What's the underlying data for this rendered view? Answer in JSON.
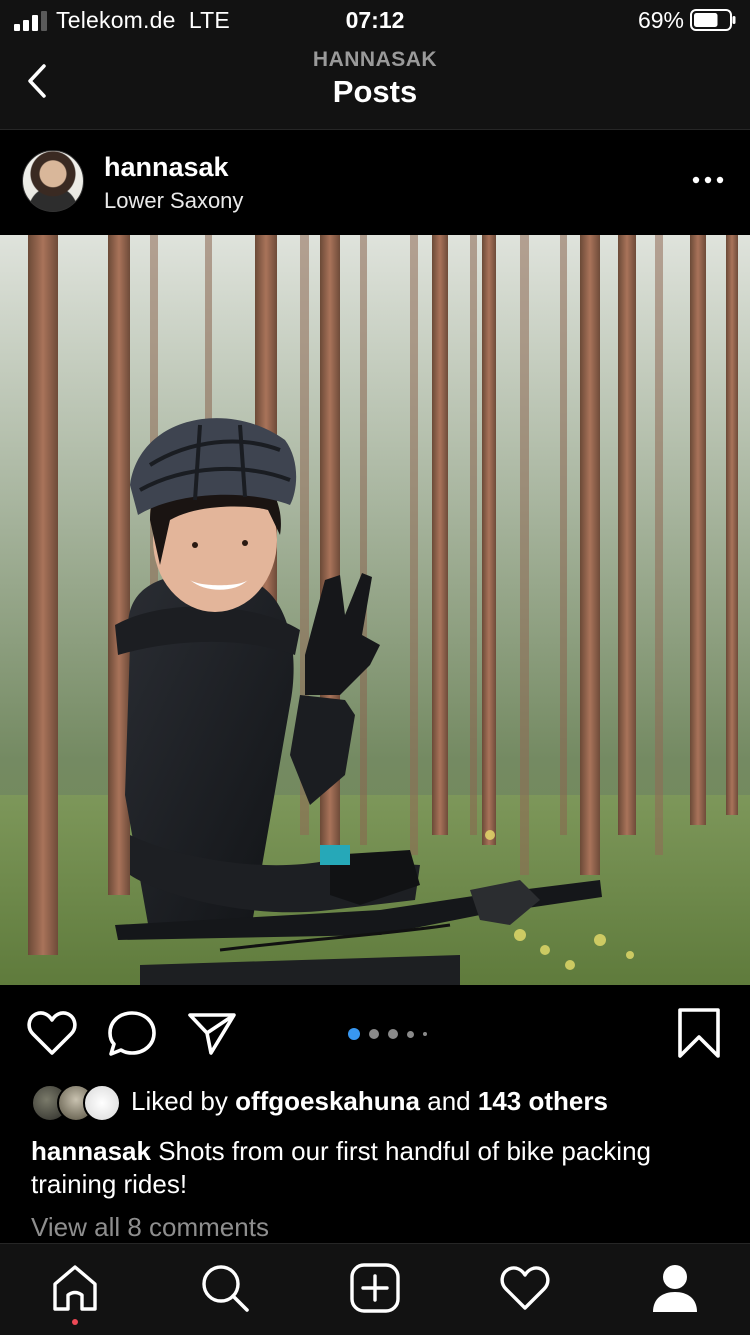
{
  "status_bar": {
    "carrier": "Telekom.de",
    "network": "LTE",
    "time": "07:12",
    "battery": "69%",
    "battery_level": 0.69
  },
  "nav": {
    "subtitle": "HANNASAK",
    "title": "Posts"
  },
  "post": {
    "username": "hannasak",
    "location": "Lower Saxony",
    "carousel": {
      "count": 5,
      "active_index": 0
    },
    "likes": {
      "prefix": "Liked by",
      "by_user": "offgoeskahuna",
      "and": "and",
      "others": "143 others"
    },
    "caption": {
      "user": "hannasak",
      "text": "Shots from our first handful of bike packing training rides!"
    },
    "view_comments": "View all 8 comments"
  },
  "colors": {
    "background": "#000000",
    "bars": "#121212",
    "accent_dot": "#3897f0",
    "notification_dot": "#ed4956",
    "muted_text": "#8e8e8e"
  },
  "icons": {
    "back": "chevron-left-icon",
    "more": "more-horizontal-icon",
    "like": "heart-outline-icon",
    "comment": "speech-bubble-icon",
    "share": "paper-plane-icon",
    "save": "bookmark-icon",
    "tabs": [
      "home-icon",
      "search-icon",
      "add-post-icon",
      "activity-heart-icon",
      "profile-icon"
    ]
  }
}
